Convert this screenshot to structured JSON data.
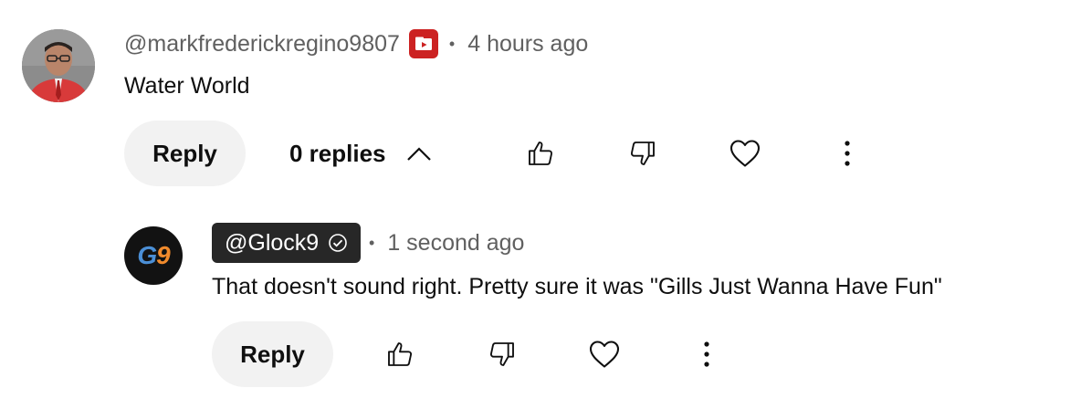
{
  "top_comment": {
    "handle": "@markfrederickregino9807",
    "badge_icon": "member-badge-icon",
    "separator": "•",
    "time": "4 hours ago",
    "text": "Water World",
    "reply_label": "Reply",
    "replies_label": "0 replies"
  },
  "reply_comment": {
    "avatar_text_1": "G",
    "avatar_text_2": "9",
    "handle": "@Glock9",
    "separator": "•",
    "time": "1 second ago",
    "text": "That doesn't sound right. Pretty sure it was \"Gills Just Wanna Have Fun\"",
    "reply_label": "Reply"
  },
  "colors": {
    "badge": "#cc2222",
    "chip": "#272727",
    "secondary_text": "#606060",
    "button_bg": "#f2f2f2"
  }
}
